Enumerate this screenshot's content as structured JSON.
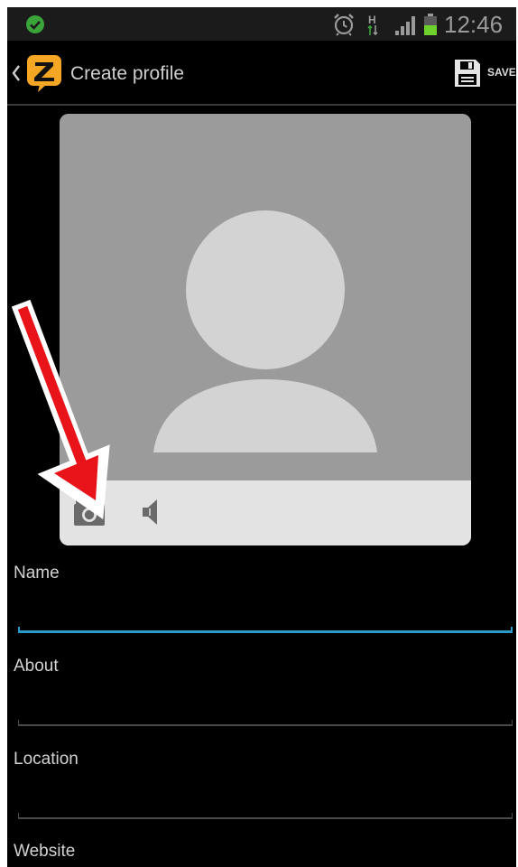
{
  "status_bar": {
    "time": "12:46",
    "network_type": "H",
    "icons": [
      "notification-check-icon",
      "alarm-clock-icon",
      "network-type-icon",
      "signal-strength-icon",
      "battery-icon"
    ]
  },
  "action_bar": {
    "title": "Create profile",
    "save_label": "SAVE",
    "icons": [
      "back-chevron-icon",
      "app-logo-icon",
      "save-disk-icon"
    ]
  },
  "photo_card": {
    "avatar": "default-avatar-silhouette",
    "toolbar_icons": [
      "camera-icon",
      "speaker-icon"
    ]
  },
  "form": {
    "fields": [
      {
        "label": "Name",
        "value": "",
        "focused": true
      },
      {
        "label": "About",
        "value": ""
      },
      {
        "label": "Location",
        "value": ""
      },
      {
        "label": "Website",
        "value": ""
      }
    ]
  },
  "annotation": {
    "type": "arrow",
    "color": "#e8141a",
    "points_to": "camera-icon"
  },
  "colors": {
    "background": "#000000",
    "accent": "#2a9bc6",
    "logo": "#f5a623"
  }
}
